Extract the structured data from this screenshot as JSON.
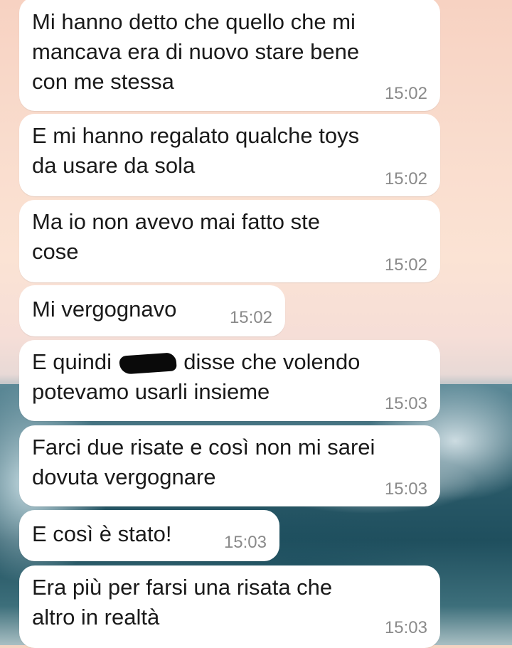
{
  "messages": [
    {
      "text": "Mi hanno detto che quello che mi\nmancava era di nuovo stare bene\ncon me stessa",
      "time": "15:02"
    },
    {
      "text": "E mi hanno regalato qualche toys\nda usare da sola",
      "time": "15:02"
    },
    {
      "text": "Ma io non avevo mai fatto ste\ncose",
      "time": "15:02"
    },
    {
      "text": "Mi vergognavo",
      "time": "15:02"
    },
    {
      "text_before": "E quindi ",
      "text_after": " disse che volendo",
      "text_line2": "potevamo usarli insieme",
      "time": "15:03"
    },
    {
      "text": "Farci due risate e così non mi sarei\ndovuta vergognare",
      "time": "15:03"
    },
    {
      "text": "E così è stato!",
      "time": "15:03"
    },
    {
      "text": "Era più per farsi una risata che\naltro in realtà",
      "time": "15:03"
    }
  ]
}
